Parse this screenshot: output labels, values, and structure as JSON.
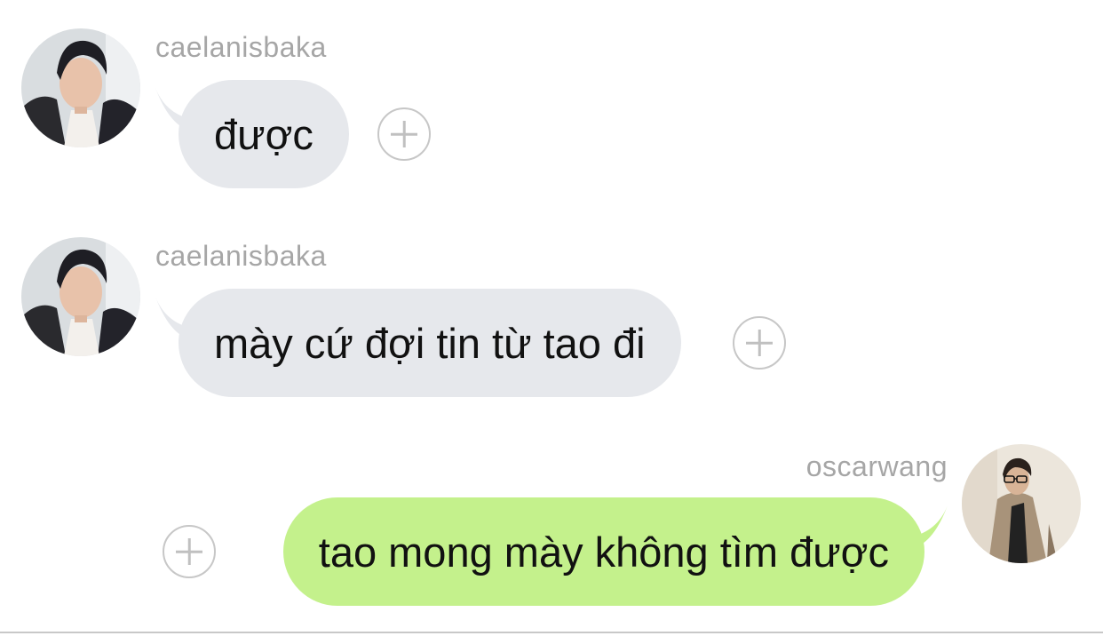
{
  "messages": [
    {
      "sender": "caelanisbaka",
      "text": "được",
      "direction": "incoming",
      "avatar_icon": "user-avatar-dark-jacket"
    },
    {
      "sender": "caelanisbaka",
      "text": "mày cứ đợi tin từ tao đi",
      "direction": "incoming",
      "avatar_icon": "user-avatar-dark-jacket"
    },
    {
      "sender": "oscarwang",
      "text": "tao mong mày không tìm được",
      "direction": "outgoing",
      "avatar_icon": "user-avatar-glasses-coat"
    }
  ],
  "reaction_icon": "add-reaction-icon",
  "colors": {
    "incoming_bubble": "#e6e8ec",
    "outgoing_bubble": "#c4f18c",
    "username": "#a6a6a6",
    "message_text": "#111111"
  }
}
